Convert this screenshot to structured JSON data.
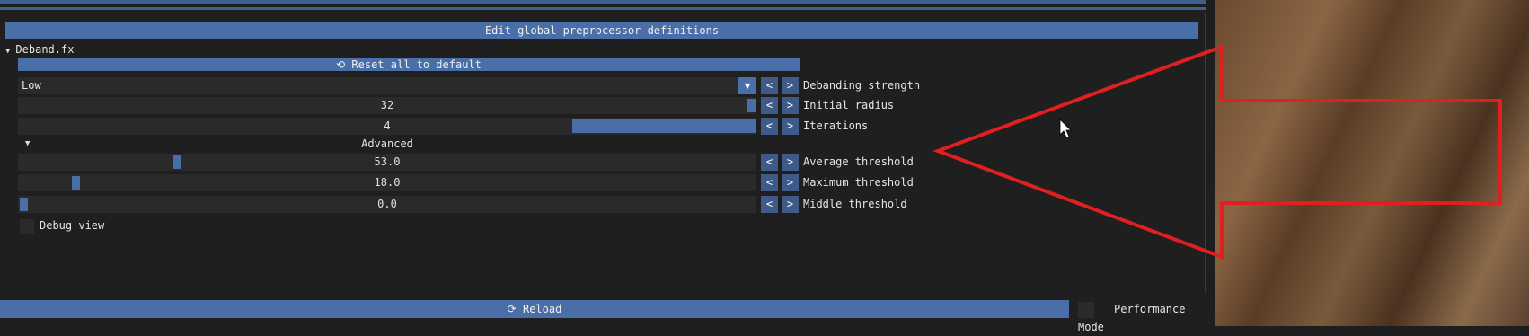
{
  "toolbar": {
    "edit_defs_label": "Edit global preprocessor definitions"
  },
  "effect": {
    "name": "Deband.fx",
    "reset_label": "Reset all to default",
    "reset_icon": "refresh-icon"
  },
  "settings": {
    "strength": {
      "value": "Low",
      "label": "Debanding strength"
    },
    "radius": {
      "value": "32",
      "label": "Initial radius",
      "fill_fraction": 1.0
    },
    "iterations": {
      "value": "4",
      "label": "Iterations"
    },
    "advanced_label": "Advanced",
    "avg_threshold": {
      "value": "53.0",
      "label": "Average threshold"
    },
    "max_threshold": {
      "value": "18.0",
      "label": "Maximum threshold"
    },
    "mid_threshold": {
      "value": "0.0",
      "label": "Middle threshold"
    },
    "debug_label": "Debug view"
  },
  "stepper": {
    "prev": "<",
    "next": ">"
  },
  "footer": {
    "reload_label": "Reload",
    "perf_label": "Performance Mode"
  },
  "colors": {
    "accent": "#4a6ea8",
    "annotation_arrow": "#e02020"
  }
}
